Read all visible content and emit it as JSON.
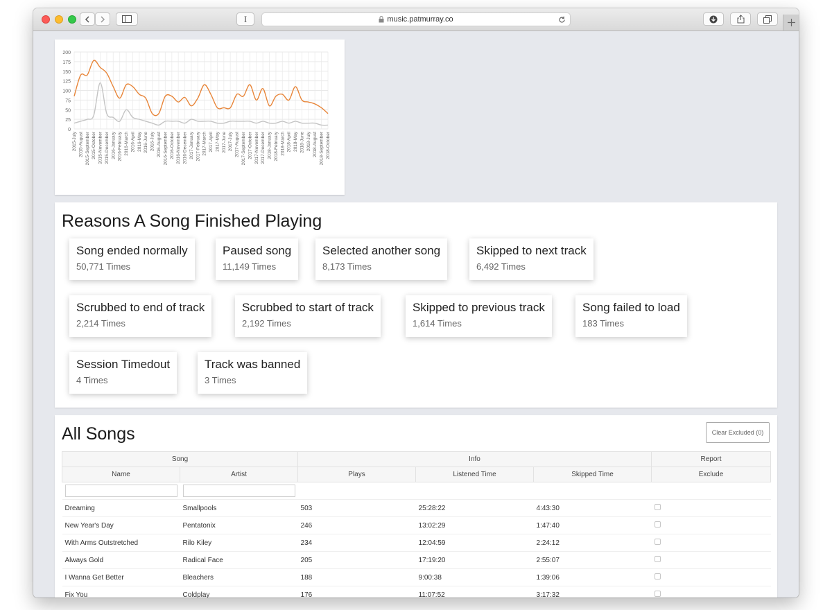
{
  "browser": {
    "url": "music.patmurray.co",
    "reader_label": "I"
  },
  "chart_data": {
    "type": "line",
    "title": "",
    "xlabel": "",
    "ylabel": "",
    "ylim": [
      0,
      200
    ],
    "yticks": [
      0,
      25,
      50,
      75,
      100,
      125,
      150,
      175,
      200
    ],
    "grid": true,
    "categories": [
      "2015-July",
      "2015-August",
      "2015-September",
      "2015-October",
      "2015-November",
      "2015-December",
      "2016-January",
      "2016-February",
      "2016-March",
      "2016-April",
      "2016-May",
      "2016-June",
      "2016-July",
      "2016-August",
      "2016-September",
      "2016-October",
      "2016-November",
      "2016-December",
      "2017-January",
      "2017-February",
      "2017-March",
      "2017-April",
      "2017-May",
      "2017-June",
      "2017-July",
      "2017-August",
      "2017-September",
      "2017-October",
      "2017-November",
      "2017-December",
      "2018-January",
      "2018-February",
      "2018-March",
      "2018-April",
      "2018-May",
      "2018-June",
      "2018-July",
      "2018-August",
      "2018-September",
      "2018-October"
    ],
    "series": [
      {
        "color": "#e8863a",
        "values": [
          85,
          140,
          140,
          178,
          160,
          145,
          110,
          80,
          115,
          110,
          90,
          80,
          40,
          40,
          85,
          85,
          70,
          82,
          60,
          80,
          115,
          90,
          55,
          55,
          55,
          90,
          85,
          115,
          75,
          105,
          60,
          85,
          90,
          75,
          110,
          75,
          70,
          65,
          55,
          40
        ]
      },
      {
        "color": "#c4c4c4",
        "values": [
          15,
          20,
          25,
          35,
          120,
          40,
          30,
          20,
          50,
          30,
          25,
          20,
          15,
          10,
          20,
          20,
          20,
          15,
          25,
          20,
          20,
          20,
          15,
          15,
          20,
          20,
          20,
          20,
          15,
          20,
          15,
          15,
          20,
          15,
          20,
          15,
          15,
          15,
          10,
          10
        ]
      }
    ]
  },
  "reasons": {
    "title": "Reasons A Song Finished Playing",
    "items": [
      {
        "label": "Song ended normally",
        "count": "50,771 Times"
      },
      {
        "label": "Paused song",
        "count": "11,149 Times"
      },
      {
        "label": "Selected another song",
        "count": "8,173 Times"
      },
      {
        "label": "Skipped to next track",
        "count": "6,492 Times"
      },
      {
        "label": "Scrubbed to end of track",
        "count": "2,214 Times"
      },
      {
        "label": "Scrubbed to start of track",
        "count": "2,192 Times"
      },
      {
        "label": "Skipped to previous track",
        "count": "1,614 Times"
      },
      {
        "label": "Song failed to load",
        "count": "183 Times"
      },
      {
        "label": "Session Timedout",
        "count": "4 Times"
      },
      {
        "label": "Track was banned",
        "count": "3 Times"
      }
    ]
  },
  "songs": {
    "title": "All Songs",
    "clear_button": "Clear Excluded (0)",
    "groups": [
      "Song",
      "Info",
      "Report"
    ],
    "columns": [
      "Name",
      "Artist",
      "Plays",
      "Listened Time",
      "Skipped Time",
      "Exclude"
    ],
    "rows": [
      {
        "name": "Dreaming",
        "artist": "Smallpools",
        "plays": "503",
        "listened": "25:28:22",
        "skipped": "4:43:30"
      },
      {
        "name": "New Year's Day",
        "artist": "Pentatonix",
        "plays": "246",
        "listened": "13:02:29",
        "skipped": "1:47:40"
      },
      {
        "name": "With Arms Outstretched",
        "artist": "Rilo Kiley",
        "plays": "234",
        "listened": "12:04:59",
        "skipped": "2:24:12"
      },
      {
        "name": "Always Gold",
        "artist": "Radical Face",
        "plays": "205",
        "listened": "17:19:20",
        "skipped": "2:55:07"
      },
      {
        "name": "I Wanna Get Better",
        "artist": "Bleachers",
        "plays": "188",
        "listened": "9:00:38",
        "skipped": "1:39:06"
      },
      {
        "name": "Fix You",
        "artist": "Coldplay",
        "plays": "176",
        "listened": "11:07:52",
        "skipped": "3:17:32"
      }
    ]
  }
}
